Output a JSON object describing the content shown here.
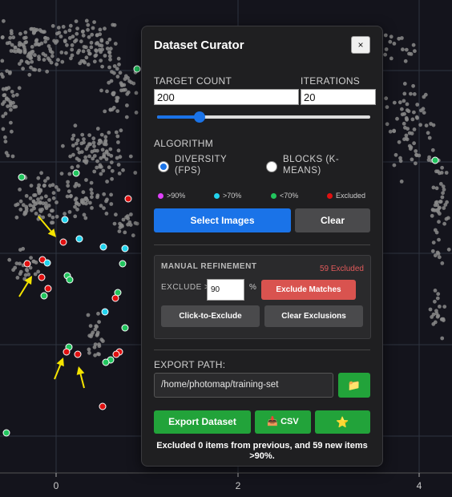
{
  "plot": {
    "x_ticks": [
      "0",
      "2",
      "4"
    ],
    "colors": {
      "background": "#14141c",
      "grid": "#2e3440",
      "point": "#8a8a8a",
      "green": "#22c55e",
      "cyan": "#22d3ee",
      "red": "#e01010",
      "arrow": "#f5e400"
    }
  },
  "panel": {
    "title": "Dataset Curator",
    "close_label": "×",
    "target_count_label": "TARGET COUNT",
    "target_count_value": "200",
    "iterations_label": "ITERATIONS",
    "iterations_value": "20",
    "slider_fraction": 0.2,
    "algorithm_label": "ALGORITHM",
    "algorithm_options": [
      {
        "label": "DIVERSITY (FPS)",
        "checked": true
      },
      {
        "label": "BLOCKS (K-MEANS)",
        "checked": false
      }
    ],
    "legend": [
      {
        "label": ">90%",
        "color": "#e040fb"
      },
      {
        "label": ">70%",
        "color": "#22d3ee"
      },
      {
        "label": "<70%",
        "color": "#22c55e"
      },
      {
        "label": "Excluded",
        "color": "#e01010"
      }
    ],
    "select_button": "Select Images",
    "clear_button": "Clear",
    "manual": {
      "title": "MANUAL REFINEMENT",
      "excluded_count": "59 Excluded",
      "exclude_label": "EXCLUDE >",
      "exclude_value": "90",
      "percent_sign": "%",
      "exclude_matches_button": "Exclude Matches",
      "click_to_exclude_button": "Click-to-Exclude",
      "clear_exclusions_button": "Clear Exclusions"
    },
    "export_path_label": "EXPORT PATH:",
    "export_path_value": "/home/photomap/training-set",
    "folder_icon": "📁",
    "export_button": "Export Dataset",
    "csv_button": "📥 CSV",
    "star_icon": "⭐",
    "status_text": "Excluded 0 items from previous, and 59 new items >90%."
  },
  "colors": {
    "primary": "#1a73e8",
    "danger": "#d9534f",
    "success": "#22a33a",
    "neutral": "#4a4a4c"
  }
}
